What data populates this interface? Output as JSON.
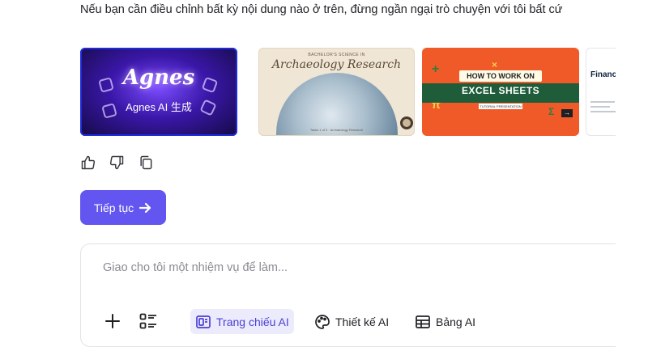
{
  "message": {
    "text": "Nếu bạn cần điều chỉnh bất kỳ nội dung nào ở trên, đừng ngần ngại trò chuyện với tôi bất cứ"
  },
  "gallery": {
    "agnes": {
      "logo": "Agnes",
      "subtitle": "Agnes AI 生成"
    },
    "archaeology": {
      "kicker": "BACHELOR'S SCIENCE IN",
      "title": "Archaeology Research",
      "footer": "Tasks 1 of 3 · Archaeology Research"
    },
    "excel": {
      "top": "HOW TO WORK ON",
      "main": "EXCEL SHEETS",
      "tag": "TUTORIAL PRESENTATION"
    },
    "finance": {
      "title": "Financ for Inv"
    }
  },
  "actions": {
    "continue_label": "Tiếp tục"
  },
  "composer": {
    "placeholder": "Giao cho tôi một nhiệm vụ để làm...",
    "tools": [
      {
        "label": "Trang chiếu AI",
        "icon": "slides-icon",
        "active": true
      },
      {
        "label": "Thiết kế AI",
        "icon": "palette-icon",
        "active": false
      },
      {
        "label": "Bảng AI",
        "icon": "table-icon",
        "active": false
      }
    ]
  },
  "colors": {
    "accent": "#6356f0",
    "active_tool_bg": "#ecebfb",
    "active_tool_text": "#4b3fd6"
  }
}
